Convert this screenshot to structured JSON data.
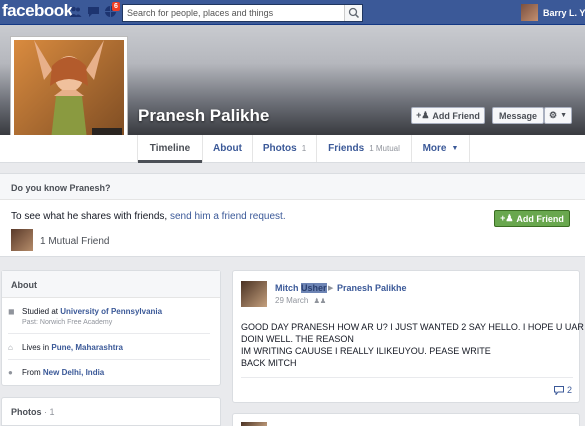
{
  "topbar": {
    "logo": "facebook",
    "notification_count": "6",
    "search_placeholder": "Search for people, places and things",
    "user_name": "Barry L. Yo"
  },
  "profile": {
    "name": "Pranesh Palikhe",
    "add_friend_label": "Add Friend",
    "message_label": "Message"
  },
  "nav": {
    "tabs": [
      {
        "label": "Timeline",
        "count": ""
      },
      {
        "label": "About",
        "count": ""
      },
      {
        "label": "Photos",
        "count": "1"
      },
      {
        "label": "Friends",
        "count": "1 Mutual"
      },
      {
        "label": "More",
        "count": ""
      }
    ]
  },
  "know": {
    "title": "Do you know Pranesh?",
    "text": "To see what he shares with friends,",
    "link": "send him a friend request.",
    "button": "Add Friend",
    "mutual": "1 Mutual Friend"
  },
  "about": {
    "title": "About",
    "studied_prefix": "Studied at",
    "studied_school": "University of Pennsylvania",
    "studied_past": "Past: Norwich Free Academy",
    "lives_prefix": "Lives in",
    "lives_place": "Pune, Maharashtra",
    "from_prefix": "From",
    "from_place": "New Delhi, India"
  },
  "photos_card": {
    "title": "Photos",
    "count": "· 1"
  },
  "post": {
    "author_first": "Mitch",
    "author_last": "Usher",
    "target": "Pranesh Palikhe",
    "date": "29 March",
    "lines": [
      "GOOD DAY PRANESH HOW AR U? I JUST WANTED 2 SAY HELLO. I HOPE U UAR",
      "DOIN WELL. THE REASON",
      "IM WRITING CAUUSE I REALLY ILIKEUYOU. PEASE WRITE",
      "BACK MITCH"
    ],
    "comment_count": "2"
  },
  "colors": {
    "brand": "#3b5998",
    "green_button": "#69a74e",
    "notification": "#f03d25"
  }
}
